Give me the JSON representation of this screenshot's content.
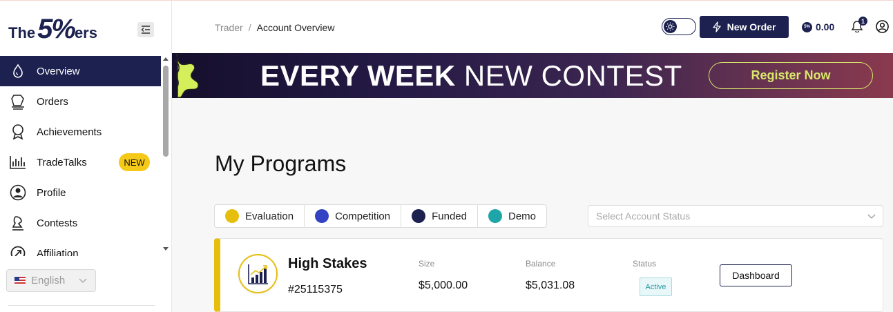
{
  "logo": {
    "the": "The",
    "five": "5%",
    "ers": "ers"
  },
  "sidebar": {
    "items": [
      {
        "label": "Overview",
        "icon": "overview-icon",
        "active": true
      },
      {
        "label": "Orders",
        "icon": "orders-icon"
      },
      {
        "label": "Achievements",
        "icon": "achievements-icon"
      },
      {
        "label": "TradeTalks",
        "icon": "tradetalks-icon",
        "badge": "NEW"
      },
      {
        "label": "Profile",
        "icon": "profile-icon"
      },
      {
        "label": "Contests",
        "icon": "contests-icon"
      },
      {
        "label": "Affiliation",
        "icon": "affiliation-icon"
      }
    ],
    "language": "English"
  },
  "header": {
    "breadcrumb": {
      "parent": "Trader",
      "separator": "/",
      "current": "Account Overview"
    },
    "new_order_label": "New Order",
    "coin_symbol": "5%",
    "balance": "0.00",
    "notification_count": "1"
  },
  "banner": {
    "bold_text": "EVERY WEEK",
    "text": "NEW CONTEST",
    "button_label": "Register Now"
  },
  "main": {
    "title": "My Programs",
    "filters": [
      {
        "label": "Evaluation",
        "color": "#e6bf0e"
      },
      {
        "label": "Competition",
        "color": "#3343c4"
      },
      {
        "label": "Funded",
        "color": "#1c2150"
      },
      {
        "label": "Demo",
        "color": "#1ea5a8"
      }
    ],
    "status_placeholder": "Select Account Status",
    "programs": [
      {
        "name": "High Stakes",
        "id": "#25115375",
        "size_label": "Size",
        "size": "$5,000.00",
        "balance_label": "Balance",
        "balance": "$5,031.08",
        "status_label": "Status",
        "status": "Active",
        "action": "Dashboard",
        "accent": "#e6bf0e"
      }
    ]
  },
  "colors": {
    "brand": "#1c2150",
    "accent_yellow": "#f5c918",
    "banner_lime": "#d9e86b"
  }
}
